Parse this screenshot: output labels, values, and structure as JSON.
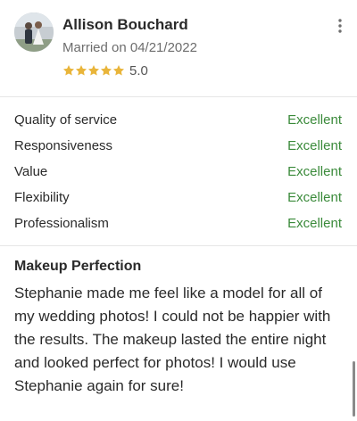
{
  "review": {
    "reviewer_name": "Allison Bouchard",
    "married_date": "Married on 04/21/2022",
    "star_count": 5,
    "rating_value": "5.0",
    "star_color": "#e9b53a",
    "ratings": [
      {
        "label": "Quality of service",
        "score": "Excellent"
      },
      {
        "label": "Responsiveness",
        "score": "Excellent"
      },
      {
        "label": "Value",
        "score": "Excellent"
      },
      {
        "label": "Flexibility",
        "score": "Excellent"
      },
      {
        "label": "Professionalism",
        "score": "Excellent"
      }
    ],
    "score_color": "#3a8a3a",
    "title": "Makeup Perfection",
    "body": "Stephanie made me feel like a model for all of my wedding photos! I could not be happier with the results. The makeup lasted the entire night and looked perfect for photos! I would use Stephanie again for sure!"
  },
  "icons": {
    "menu": "more-vertical-icon",
    "star": "star-icon",
    "avatar": "avatar-photo"
  }
}
